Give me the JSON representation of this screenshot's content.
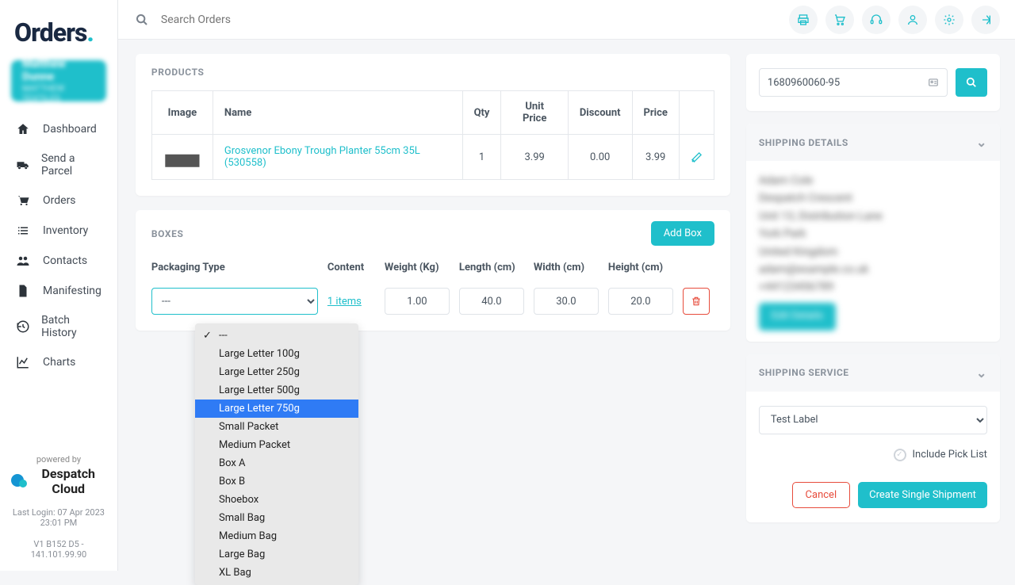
{
  "logo": {
    "text": "Orders",
    "dot": "."
  },
  "user": {
    "name": "Matthew Dunne",
    "sub": "MATTHEW TEXTILES"
  },
  "nav": [
    {
      "label": "Dashboard",
      "icon": "home"
    },
    {
      "label": "Send a Parcel",
      "icon": "truck"
    },
    {
      "label": "Orders",
      "icon": "cart"
    },
    {
      "label": "Inventory",
      "icon": "list"
    },
    {
      "label": "Contacts",
      "icon": "people"
    },
    {
      "label": "Manifesting",
      "icon": "file"
    },
    {
      "label": "Batch History",
      "icon": "history"
    },
    {
      "label": "Charts",
      "icon": "chart"
    }
  ],
  "powered_by": "powered by",
  "brand": "Despatch Cloud",
  "last_login": "Last Login: 07 Apr 2023 23:01 PM",
  "version": "V1 B152 D5 - 141.101.99.90",
  "search_placeholder": "Search Orders",
  "products": {
    "title": "PRODUCTS",
    "headers": {
      "image": "Image",
      "name": "Name",
      "qty": "Qty",
      "unit": "Unit Price",
      "discount": "Discount",
      "price": "Price"
    },
    "rows": [
      {
        "name": "Grosvenor Ebony Trough Planter 55cm 35L (530558)",
        "qty": "1",
        "unit": "3.99",
        "discount": "0.00",
        "price": "3.99"
      }
    ]
  },
  "boxes": {
    "title": "BOXES",
    "add": "Add Box",
    "headers": {
      "pkg": "Packaging Type",
      "content": "Content",
      "weight": "Weight (Kg)",
      "length": "Length (cm)",
      "width": "Width (cm)",
      "height": "Height (cm)"
    },
    "row": {
      "content": "1 items",
      "weight": "1.00",
      "length": "40.0",
      "width": "30.0",
      "height": "20.0"
    },
    "options": [
      "---",
      "Large Letter 100g",
      "Large Letter 250g",
      "Large Letter 500g",
      "Large Letter 750g",
      "Small Packet",
      "Medium Packet",
      "Box A",
      "Box B",
      "Shoebox",
      "Small Bag",
      "Medium Bag",
      "Large Bag",
      "XL Bag"
    ],
    "selected_index": 0,
    "highlight_index": 4
  },
  "order_search_value": "1680960060-95",
  "shipping_details": {
    "title": "SHIPPING DETAILS",
    "lines": [
      "Adam Cole",
      "Despatch Crescent",
      "Unit 13, Distribution Lane",
      "York Park",
      "United Kingdom",
      "adam@example.co.uk",
      "+44123456789"
    ],
    "button": "Edit Details"
  },
  "shipping_service": {
    "title": "SHIPPING SERVICE",
    "selected": "Test Label",
    "picklist": "Include Pick List",
    "cancel": "Cancel",
    "create": "Create Single Shipment"
  }
}
